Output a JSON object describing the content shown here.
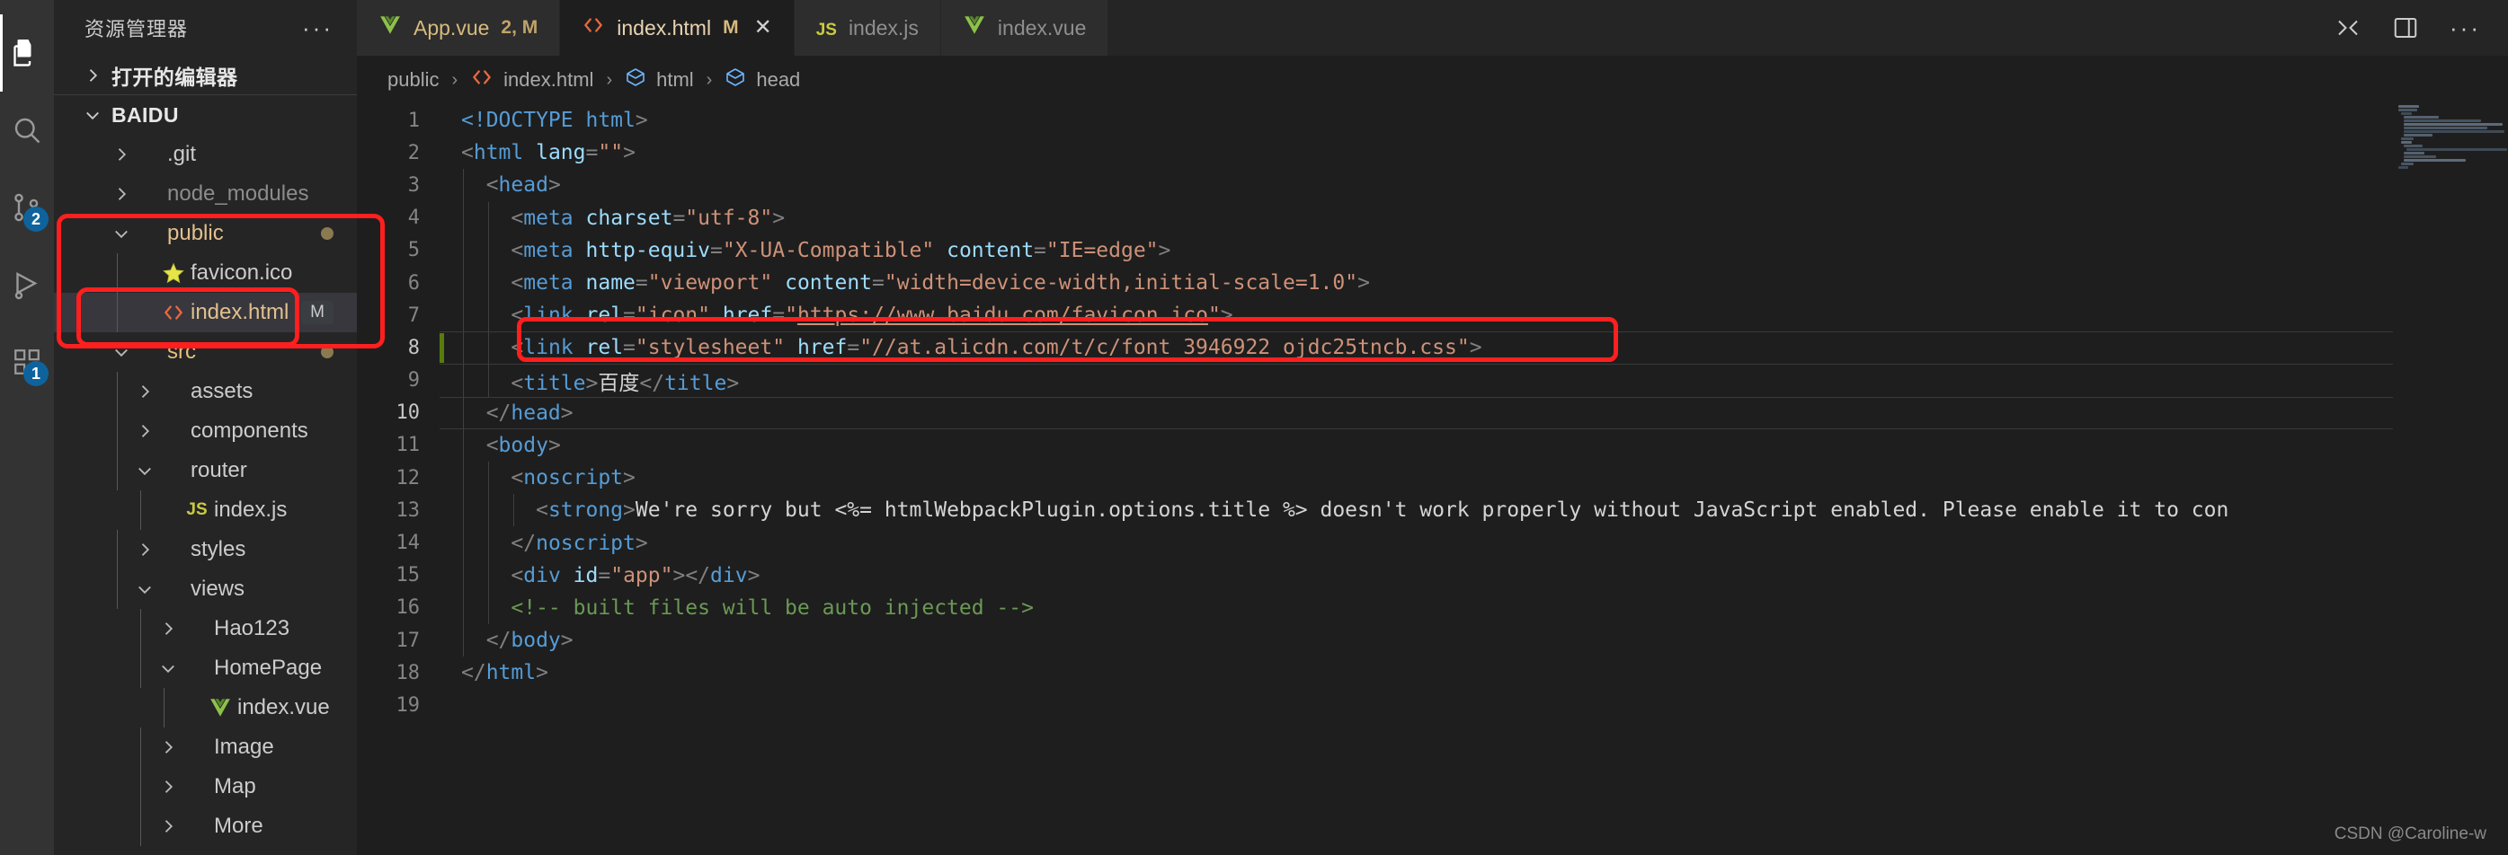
{
  "activitybar": {
    "items": [
      {
        "name": "explorer",
        "icon": "files-icon",
        "active": true,
        "badge": ""
      },
      {
        "name": "search",
        "icon": "search-icon",
        "active": false,
        "badge": ""
      },
      {
        "name": "source-control",
        "icon": "source-control-icon",
        "active": false,
        "badge": "2"
      },
      {
        "name": "run-and-debug",
        "icon": "run-debug-icon",
        "active": false,
        "badge": ""
      },
      {
        "name": "extensions",
        "icon": "extensions-icon",
        "active": false,
        "badge": "1"
      }
    ]
  },
  "sidebar": {
    "title": "资源管理器",
    "more_label": "···",
    "open_editors_label": "打开的编辑器",
    "root_label": "BAIDU",
    "tree": [
      {
        "label": ".git",
        "indent": 1,
        "kind": "folder",
        "state": "collapsed",
        "color": "plain",
        "icon": "",
        "decoration": ""
      },
      {
        "label": "node_modules",
        "indent": 1,
        "kind": "folder",
        "state": "collapsed",
        "color": "dim",
        "icon": "",
        "decoration": ""
      },
      {
        "label": "public",
        "indent": 1,
        "kind": "folder",
        "state": "expanded",
        "color": "folder-mod",
        "icon": "",
        "decoration": "dot"
      },
      {
        "label": "favicon.ico",
        "indent": 2,
        "kind": "file",
        "state": "none",
        "color": "plain",
        "icon": "star-icon",
        "decoration": ""
      },
      {
        "label": "index.html",
        "indent": 2,
        "kind": "file",
        "state": "none",
        "color": "file-mod",
        "icon": "html-icon",
        "decoration": "M",
        "selected": true
      },
      {
        "label": "src",
        "indent": 1,
        "kind": "folder",
        "state": "expanded",
        "color": "src",
        "icon": "",
        "decoration": "dot"
      },
      {
        "label": "assets",
        "indent": 2,
        "kind": "folder",
        "state": "collapsed",
        "color": "plain",
        "icon": "",
        "decoration": ""
      },
      {
        "label": "components",
        "indent": 2,
        "kind": "folder",
        "state": "collapsed",
        "color": "plain",
        "icon": "",
        "decoration": ""
      },
      {
        "label": "router",
        "indent": 2,
        "kind": "folder",
        "state": "expanded",
        "color": "plain",
        "icon": "",
        "decoration": ""
      },
      {
        "label": "index.js",
        "indent": 3,
        "kind": "file",
        "state": "none",
        "color": "plain",
        "icon": "js-icon",
        "decoration": ""
      },
      {
        "label": "styles",
        "indent": 2,
        "kind": "folder",
        "state": "collapsed",
        "color": "plain",
        "icon": "",
        "decoration": ""
      },
      {
        "label": "views",
        "indent": 2,
        "kind": "folder",
        "state": "expanded",
        "color": "plain",
        "icon": "",
        "decoration": ""
      },
      {
        "label": "Hao123",
        "indent": 3,
        "kind": "folder",
        "state": "collapsed",
        "color": "plain",
        "icon": "",
        "decoration": ""
      },
      {
        "label": "HomePage",
        "indent": 3,
        "kind": "folder",
        "state": "expanded",
        "color": "plain",
        "icon": "",
        "decoration": ""
      },
      {
        "label": "index.vue",
        "indent": 4,
        "kind": "file",
        "state": "none",
        "color": "plain",
        "icon": "vue-icon",
        "decoration": ""
      },
      {
        "label": "Image",
        "indent": 3,
        "kind": "folder",
        "state": "collapsed",
        "color": "plain",
        "icon": "",
        "decoration": ""
      },
      {
        "label": "Map",
        "indent": 3,
        "kind": "folder",
        "state": "collapsed",
        "color": "plain",
        "icon": "",
        "decoration": ""
      },
      {
        "label": "More",
        "indent": 3,
        "kind": "folder",
        "state": "collapsed",
        "color": "plain",
        "icon": "",
        "decoration": ""
      }
    ]
  },
  "tabs": [
    {
      "label": "App.vue",
      "icon": "vue-icon",
      "badge": "2, M",
      "active": false,
      "closable": false
    },
    {
      "label": "index.html",
      "icon": "html-icon",
      "badge": "M",
      "active": true,
      "closable": true,
      "close_glyph": "✕"
    },
    {
      "label": "index.js",
      "icon": "js-icon",
      "badge": "",
      "active": false,
      "closable": false
    },
    {
      "label": "index.vue",
      "icon": "vue-icon",
      "badge": "",
      "active": false,
      "closable": false
    }
  ],
  "breadcrumbs": [
    {
      "label": "public",
      "icon": ""
    },
    {
      "label": "index.html",
      "icon": "html-icon"
    },
    {
      "label": "html",
      "icon": "symbol-cube-icon"
    },
    {
      "label": "head",
      "icon": "symbol-cube-icon"
    }
  ],
  "breadcrumb_separator": "›",
  "editor": {
    "current_line": 8,
    "lines": [
      {
        "n": 1,
        "indent": 0,
        "tokens": [
          {
            "t": "<!DOCTYPE ",
            "c": "t-doctype"
          },
          {
            "t": "html",
            "c": "t-doctype"
          },
          {
            "t": ">",
            "c": "t-punct"
          }
        ]
      },
      {
        "n": 2,
        "indent": 0,
        "tokens": [
          {
            "t": "<",
            "c": "t-punct"
          },
          {
            "t": "html",
            "c": "t-tag"
          },
          {
            "t": " ",
            "c": "t-text"
          },
          {
            "t": "lang",
            "c": "t-attr"
          },
          {
            "t": "=",
            "c": "t-punct"
          },
          {
            "t": "\"\"",
            "c": "t-str"
          },
          {
            "t": ">",
            "c": "t-punct"
          }
        ]
      },
      {
        "n": 3,
        "indent": 1,
        "tokens": [
          {
            "t": "  <",
            "c": "t-punct"
          },
          {
            "t": "head",
            "c": "t-tag"
          },
          {
            "t": ">",
            "c": "t-punct"
          }
        ]
      },
      {
        "n": 4,
        "indent": 2,
        "tokens": [
          {
            "t": "    <",
            "c": "t-punct"
          },
          {
            "t": "meta",
            "c": "t-tag"
          },
          {
            "t": " ",
            "c": "t-text"
          },
          {
            "t": "charset",
            "c": "t-attr"
          },
          {
            "t": "=",
            "c": "t-punct"
          },
          {
            "t": "\"utf-8\"",
            "c": "t-str"
          },
          {
            "t": ">",
            "c": "t-punct"
          }
        ]
      },
      {
        "n": 5,
        "indent": 2,
        "tokens": [
          {
            "t": "    <",
            "c": "t-punct"
          },
          {
            "t": "meta",
            "c": "t-tag"
          },
          {
            "t": " ",
            "c": "t-text"
          },
          {
            "t": "http-equiv",
            "c": "t-attr"
          },
          {
            "t": "=",
            "c": "t-punct"
          },
          {
            "t": "\"X-UA-Compatible\"",
            "c": "t-str"
          },
          {
            "t": " ",
            "c": "t-text"
          },
          {
            "t": "content",
            "c": "t-attr"
          },
          {
            "t": "=",
            "c": "t-punct"
          },
          {
            "t": "\"IE=edge\"",
            "c": "t-str"
          },
          {
            "t": ">",
            "c": "t-punct"
          }
        ]
      },
      {
        "n": 6,
        "indent": 2,
        "tokens": [
          {
            "t": "    <",
            "c": "t-punct"
          },
          {
            "t": "meta",
            "c": "t-tag"
          },
          {
            "t": " ",
            "c": "t-text"
          },
          {
            "t": "name",
            "c": "t-attr"
          },
          {
            "t": "=",
            "c": "t-punct"
          },
          {
            "t": "\"viewport\"",
            "c": "t-str"
          },
          {
            "t": " ",
            "c": "t-text"
          },
          {
            "t": "content",
            "c": "t-attr"
          },
          {
            "t": "=",
            "c": "t-punct"
          },
          {
            "t": "\"width=device-width,initial-scale=1.0\"",
            "c": "t-str"
          },
          {
            "t": ">",
            "c": "t-punct"
          }
        ]
      },
      {
        "n": 7,
        "indent": 2,
        "tokens": [
          {
            "t": "    <",
            "c": "t-punct"
          },
          {
            "t": "link",
            "c": "t-tag"
          },
          {
            "t": " ",
            "c": "t-text"
          },
          {
            "t": "rel",
            "c": "t-attr"
          },
          {
            "t": "=",
            "c": "t-punct"
          },
          {
            "t": "\"icon\"",
            "c": "t-str"
          },
          {
            "t": " ",
            "c": "t-text"
          },
          {
            "t": "href",
            "c": "t-attr"
          },
          {
            "t": "=",
            "c": "t-punct"
          },
          {
            "t": "\"",
            "c": "t-str"
          },
          {
            "t": "https://www.baidu.com/favicon.ico",
            "c": "t-link"
          },
          {
            "t": "\"",
            "c": "t-str"
          },
          {
            "t": ">",
            "c": "t-punct"
          }
        ]
      },
      {
        "n": 8,
        "indent": 2,
        "current": true,
        "git_modified": true,
        "tokens": [
          {
            "t": "    <",
            "c": "t-punct"
          },
          {
            "t": "link",
            "c": "t-tag"
          },
          {
            "t": " ",
            "c": "t-text"
          },
          {
            "t": "rel",
            "c": "t-attr"
          },
          {
            "t": "=",
            "c": "t-punct"
          },
          {
            "t": "\"stylesheet\"",
            "c": "t-str"
          },
          {
            "t": " ",
            "c": "t-text"
          },
          {
            "t": "href",
            "c": "t-attr"
          },
          {
            "t": "=",
            "c": "t-punct"
          },
          {
            "t": "\"//at.alicdn.com/t/c/font_3946922_ojdc25tncb.css\"",
            "c": "t-str"
          },
          {
            "t": ">",
            "c": "t-punct"
          }
        ]
      },
      {
        "n": 9,
        "indent": 2,
        "tokens": [
          {
            "t": "    <",
            "c": "t-punct"
          },
          {
            "t": "title",
            "c": "t-tag"
          },
          {
            "t": ">",
            "c": "t-punct"
          },
          {
            "t": "百度",
            "c": "t-text"
          },
          {
            "t": "</",
            "c": "t-punct"
          },
          {
            "t": "title",
            "c": "t-tag"
          },
          {
            "t": ">",
            "c": "t-punct"
          }
        ]
      },
      {
        "n": 10,
        "indent": 1,
        "tokens": [
          {
            "t": "  </",
            "c": "t-punct"
          },
          {
            "t": "head",
            "c": "t-tag"
          },
          {
            "t": ">",
            "c": "t-punct"
          }
        ]
      },
      {
        "n": 11,
        "indent": 1,
        "tokens": [
          {
            "t": "  <",
            "c": "t-punct"
          },
          {
            "t": "body",
            "c": "t-tag"
          },
          {
            "t": ">",
            "c": "t-punct"
          }
        ]
      },
      {
        "n": 12,
        "indent": 2,
        "tokens": [
          {
            "t": "    <",
            "c": "t-punct"
          },
          {
            "t": "noscript",
            "c": "t-tag"
          },
          {
            "t": ">",
            "c": "t-punct"
          }
        ]
      },
      {
        "n": 13,
        "indent": 3,
        "tokens": [
          {
            "t": "      <",
            "c": "t-punct"
          },
          {
            "t": "strong",
            "c": "t-tag"
          },
          {
            "t": ">",
            "c": "t-punct"
          },
          {
            "t": "We're sorry but <%= htmlWebpackPlugin.options.title %> doesn't work properly without JavaScript enabled. Please enable it to con",
            "c": "t-text"
          }
        ]
      },
      {
        "n": 14,
        "indent": 2,
        "tokens": [
          {
            "t": "    </",
            "c": "t-punct"
          },
          {
            "t": "noscript",
            "c": "t-tag"
          },
          {
            "t": ">",
            "c": "t-punct"
          }
        ]
      },
      {
        "n": 15,
        "indent": 2,
        "tokens": [
          {
            "t": "    <",
            "c": "t-punct"
          },
          {
            "t": "div",
            "c": "t-tag"
          },
          {
            "t": " ",
            "c": "t-text"
          },
          {
            "t": "id",
            "c": "t-attr"
          },
          {
            "t": "=",
            "c": "t-punct"
          },
          {
            "t": "\"app\"",
            "c": "t-str"
          },
          {
            "t": ">",
            "c": "t-punct"
          },
          {
            "t": "</",
            "c": "t-punct"
          },
          {
            "t": "div",
            "c": "t-tag"
          },
          {
            "t": ">",
            "c": "t-punct"
          }
        ]
      },
      {
        "n": 16,
        "indent": 2,
        "tokens": [
          {
            "t": "    <!-- built files will be auto injected -->",
            "c": "t-comment"
          }
        ]
      },
      {
        "n": 17,
        "indent": 1,
        "tokens": [
          {
            "t": "  </",
            "c": "t-punct"
          },
          {
            "t": "body",
            "c": "t-tag"
          },
          {
            "t": ">",
            "c": "t-punct"
          }
        ]
      },
      {
        "n": 18,
        "indent": 0,
        "tokens": [
          {
            "t": "</",
            "c": "t-punct"
          },
          {
            "t": "html",
            "c": "t-tag"
          },
          {
            "t": ">",
            "c": "t-punct"
          }
        ]
      },
      {
        "n": 19,
        "indent": 0,
        "tokens": []
      }
    ]
  },
  "topright": {
    "items": [
      {
        "name": "split-editor-right-icon"
      },
      {
        "name": "toggle-panel-icon"
      },
      {
        "name": "more-actions-icon",
        "label": "···"
      }
    ]
  },
  "annotations": {
    "public_box": "highlight-public-folder",
    "index_html_box": "highlight-index-html-file",
    "line8_box": "highlight-stylesheet-link-line"
  },
  "watermark": "CSDN @Caroline-w",
  "colors": {
    "accent_red": "#ff1f1f",
    "activity_bg": "#333333",
    "sidebar_bg": "#252526",
    "editor_bg": "#1e1e1e",
    "tab_active_bg": "#1e1e1e",
    "badge_blue": "#0e639c",
    "git_modified_green": "#587c0c"
  }
}
